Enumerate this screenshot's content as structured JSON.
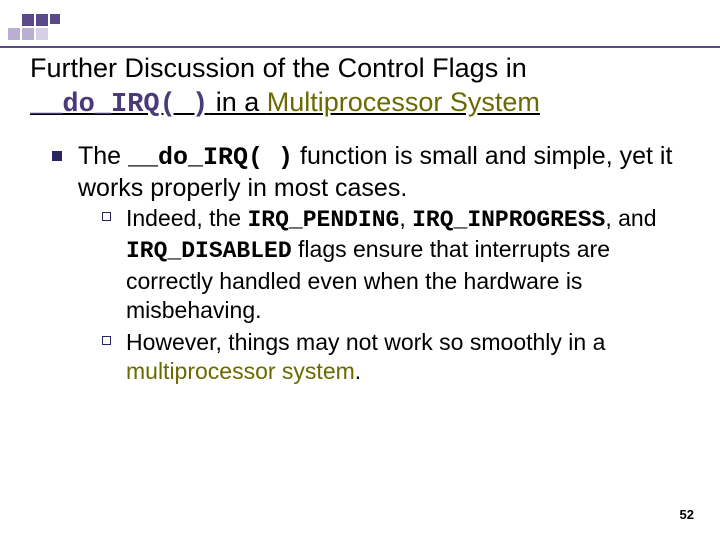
{
  "title": {
    "line1": "Further Discussion of the Control Flags in",
    "code": "__do_IRQ( )",
    "after_code": " in a ",
    "mp_text": "Multiprocessor System"
  },
  "point1": {
    "prefix": "The ",
    "code": "__do_IRQ( )",
    "rest": " function is small and simple, yet it works properly in most cases."
  },
  "sub1": {
    "a": "Indeed, the ",
    "flag1": "IRQ_PENDING",
    "b": ", ",
    "flag2": "IRQ_INPROGRESS",
    "c": ", and ",
    "flag3": "IRQ_DISABLED",
    "d": " flags ensure that interrupts are correctly handled even when the hardware is misbehaving."
  },
  "sub2": {
    "a": "However, things may not work so smoothly in a ",
    "mp": "multiprocessor system",
    "b": "."
  },
  "slide_number": "52"
}
